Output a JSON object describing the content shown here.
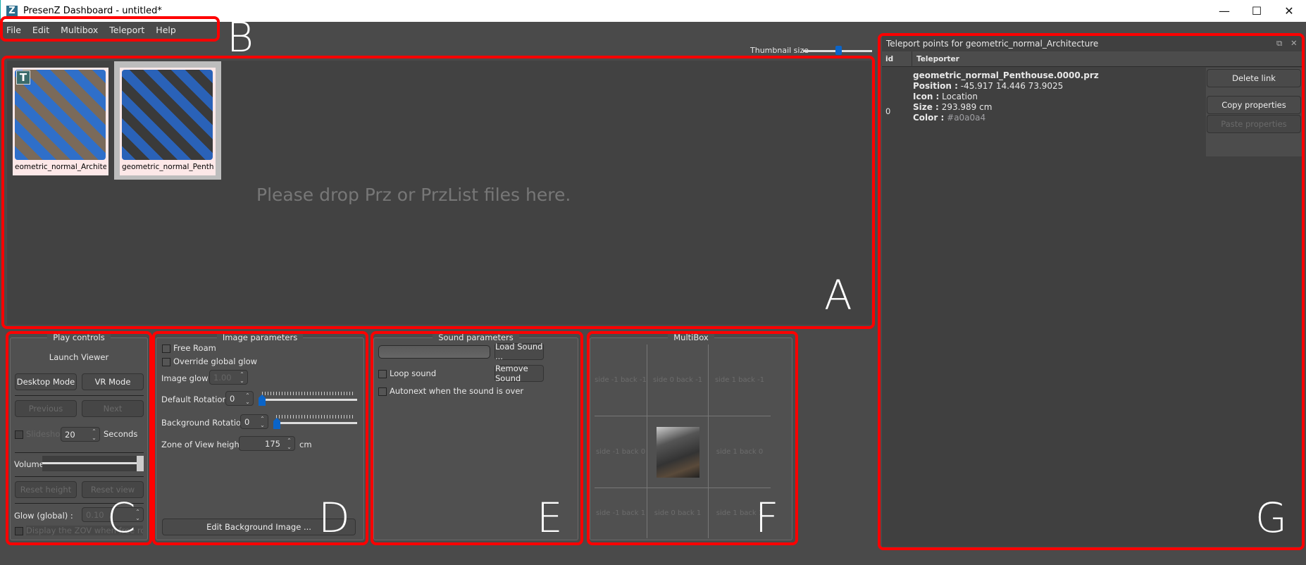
{
  "window": {
    "title": "PresenZ Dashboard - untitled*",
    "logo": "Z",
    "min": "—",
    "max": "☐",
    "close": "✕"
  },
  "menu": [
    "File",
    "Edit",
    "Multibox",
    "Teleport",
    "Help"
  ],
  "thumbnail_size": {
    "label": "Thumbnail size",
    "value": 0.5
  },
  "drop_area": {
    "placeholder": "Please drop Prz or PrzList files here.",
    "items": [
      {
        "caption": "eometric_normal_Architectur",
        "badge": "T"
      },
      {
        "caption": "geometric_normal_Penthouse",
        "selected": true
      }
    ]
  },
  "play": {
    "title": "Play controls",
    "launch": "Launch Viewer",
    "desktop": "Desktop Mode",
    "vr": "VR Mode",
    "previous": "Previous",
    "next": "Next",
    "slideshow": "Slideshow",
    "seconds_value": "20",
    "seconds": "Seconds",
    "volume": "Volume",
    "volume_level": 1.0,
    "reset_height": "Reset height",
    "reset_view": "Reset view",
    "glow_label": "Glow (global) :",
    "glow_value": "0.10",
    "display_zov": "Display the ZOV when free roaming"
  },
  "image": {
    "title": "Image parameters",
    "free_roam": "Free Roam",
    "override_glow": "Override global glow",
    "image_glow": "Image glow :",
    "image_glow_value": "1.00",
    "default_rotation": "Default Rotation :",
    "default_rotation_value": "0",
    "background_rotation": "Background Rotation :",
    "background_rotation_value": "0",
    "zov_height": "Zone of View height :",
    "zov_value": "175",
    "zov_unit": "cm",
    "edit_bg": "Edit Background Image ..."
  },
  "sound": {
    "title": "Sound parameters",
    "load": "Load Sound ...",
    "remove": "Remove Sound",
    "loop": "Loop sound",
    "autonext": "Autonext when the sound is over"
  },
  "multibox": {
    "title": "MultiBox",
    "cells": [
      "side -1 back -1",
      "side 0 back -1",
      "side 1 back -1",
      "side -1 back 0",
      "",
      "side 1 back 0",
      "side -1 back 1",
      "side 0 back 1",
      "side 1 back 1"
    ]
  },
  "teleport": {
    "title": "Teleport points for geometric_normal_Architecture",
    "columns": [
      "id",
      "Teleporter"
    ],
    "rows": [
      {
        "id": "0",
        "file": "geometric_normal_Penthouse.0000.prz",
        "position_label": "Position :",
        "position": "-45.917 14.446 73.9025",
        "icon_label": "Icon :",
        "icon": "Location",
        "size_label": "Size :",
        "size": "293.989 cm",
        "color_label": "Color :",
        "color": "#a0a0a4"
      }
    ],
    "delete": "Delete link",
    "copy": "Copy properties",
    "paste": "Paste properties"
  },
  "annotations": [
    "A",
    "B",
    "C",
    "D",
    "E",
    "F",
    "G"
  ],
  "colors": {
    "accent": "#0a64c8",
    "annotation": "#ff0000"
  }
}
